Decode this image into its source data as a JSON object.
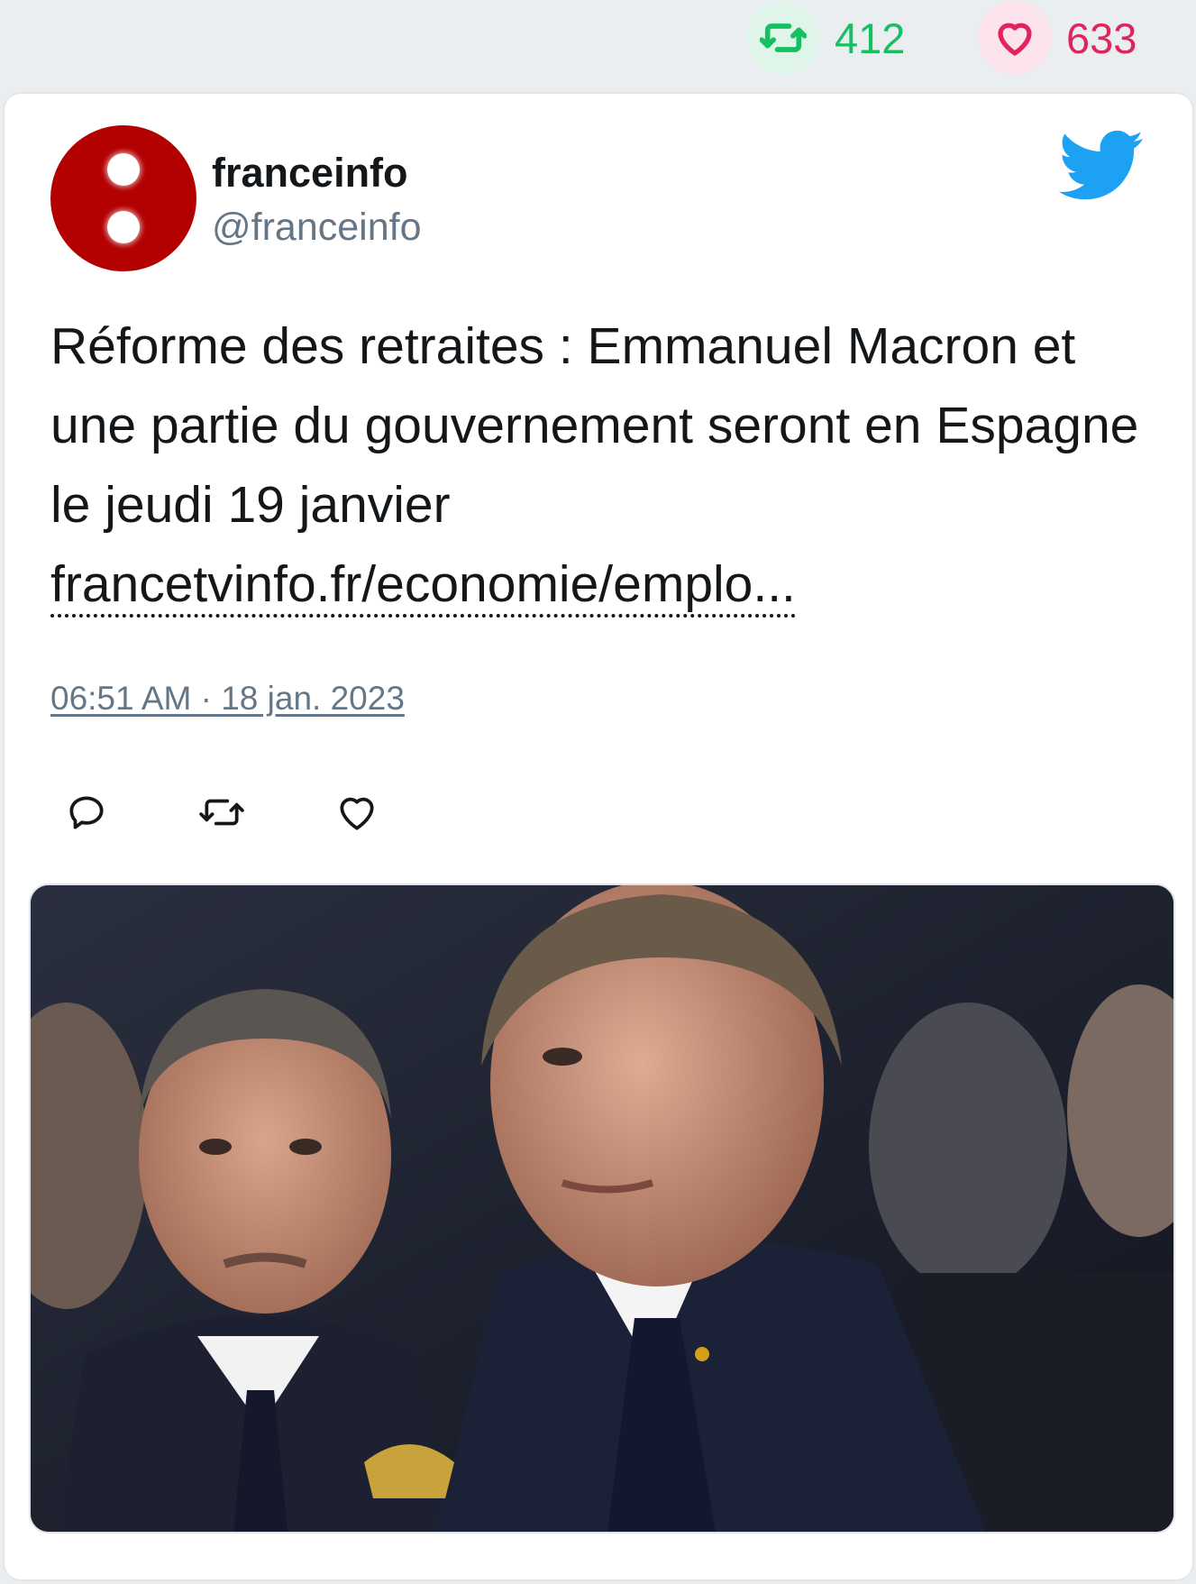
{
  "stats": {
    "retweets": "412",
    "likes": "633",
    "retweet_color": "#17bf63",
    "like_color": "#e0245e"
  },
  "tweet": {
    "author_name": "franceinfo",
    "author_handle": "@franceinfo",
    "text": "Réforme des retraites : Emmanuel Macron et une partie du gouvernement seront en Espagne le jeudi 19 janvier",
    "link_text": "francetvinfo.fr/economie/emplo...",
    "timestamp": "06:51 AM · 18 jan. 2023",
    "brand_color": "#1da1f2",
    "avatar_color": "#b30000"
  },
  "icons": {
    "stat_retweet": "retweet-icon",
    "stat_like": "heart-icon",
    "brand": "twitter-bird-icon",
    "reply": "reply-icon",
    "retweet": "retweet-icon",
    "like": "heart-icon"
  }
}
